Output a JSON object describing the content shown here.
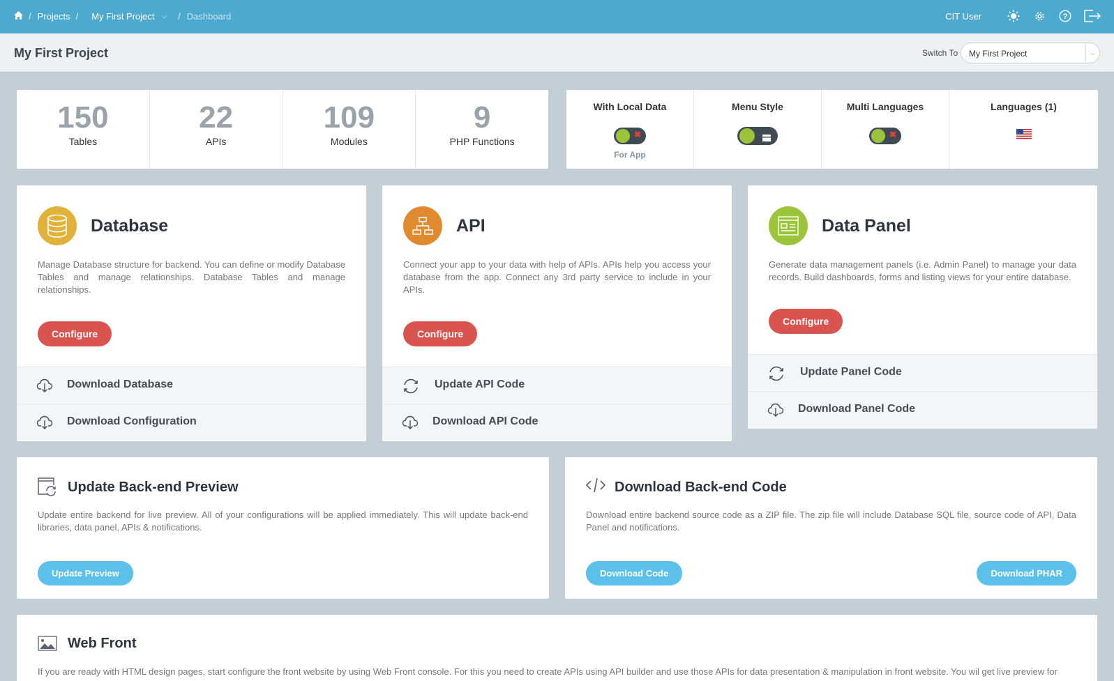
{
  "topbar": {
    "crumb_projects": "Projects",
    "crumb_project": "My First Project",
    "crumb_current": "Dashboard",
    "user": "CIT User"
  },
  "subheader": {
    "title": "My First Project",
    "switch_label": "Switch To",
    "switch_value": "My First Project"
  },
  "stats": [
    {
      "value": "150",
      "label": "Tables"
    },
    {
      "value": "22",
      "label": "APIs"
    },
    {
      "value": "109",
      "label": "Modules"
    },
    {
      "value": "9",
      "label": "PHP Functions"
    }
  ],
  "toggles": {
    "local_data": {
      "label": "With Local Data",
      "sub": "For App"
    },
    "menu_style": {
      "label": "Menu Style"
    },
    "multi_lang": {
      "label": "Multi Languages"
    },
    "languages": {
      "label": "Languages (1)"
    }
  },
  "database": {
    "title": "Database",
    "desc": "Manage Database structure for backend. You can define or modify Database Tables and manage relationships. Database Tables and manage relationships.",
    "button": "Configure",
    "link1": "Download Database",
    "link2": "Download Configuration"
  },
  "api": {
    "title": "API",
    "desc": "Connect your app to your data with help of APIs. APIs help you access your database from the app. Connect any 3rd party service to include in your APIs.",
    "button": "Configure",
    "link1": "Update API Code",
    "link2": "Download API Code"
  },
  "datapanel": {
    "title": "Data Panel",
    "desc": "Generate data management panels (i.e. Admin Panel) to manage your data records. Build dashboards, forms and listing views for your entire database.",
    "button": "Configure",
    "link1": "Update Panel Code",
    "link2": "Download Panel Code"
  },
  "preview": {
    "title": "Update Back-end Preview",
    "desc": "Update entire backend for live preview. All of your configurations will be applied immediately. This will update back-end libraries, data panel, APIs & notifications.",
    "button": "Update Preview"
  },
  "backend_code": {
    "title": "Download Back-end Code",
    "desc": "Download entire backend source code as a ZIP file. The zip file will include Database SQL file, source code of API, Data Panel and notifications.",
    "button1": "Download Code",
    "button2": "Download PHAR"
  },
  "webfront": {
    "title": "Web Front",
    "desc": "If you are ready with HTML design pages, start configure the front website by using Web Front console. For this you need to create APIs using API builder and use those APIs for data presentation & manipulation in front website. You wil get live preview for"
  },
  "colors": {
    "topbar": "#4ea9cf",
    "database": "#e0b23a",
    "api": "#e08a30",
    "datapanel": "#9bc43a",
    "configure": "#d9534f",
    "blue_button": "#5bc0ea"
  }
}
